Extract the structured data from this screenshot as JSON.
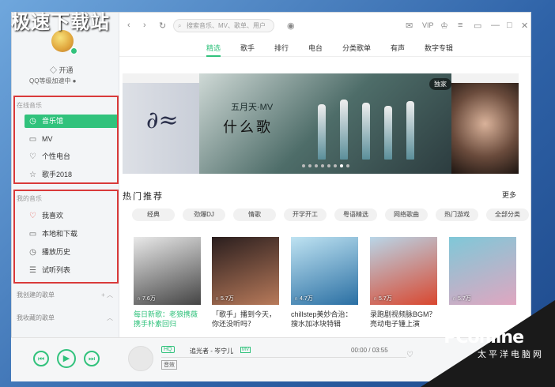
{
  "watermark_top": "极速下载站",
  "sidebar": {
    "vip_label": "开通",
    "qq_accel": "QQ等级加速中",
    "online_section": "在线音乐",
    "online_items": [
      {
        "label": "音乐馆",
        "icon": "music-hall-icon",
        "active": true
      },
      {
        "label": "MV",
        "icon": "mv-icon",
        "active": false
      },
      {
        "label": "个性电台",
        "icon": "radio-icon",
        "active": false
      },
      {
        "label": "歌手2018",
        "icon": "star-icon",
        "active": false
      }
    ],
    "my_section": "我的音乐",
    "my_items": [
      {
        "label": "我喜欢",
        "icon": "heart-icon"
      },
      {
        "label": "本地和下载",
        "icon": "monitor-icon"
      },
      {
        "label": "播放历史",
        "icon": "clock-icon"
      },
      {
        "label": "试听列表",
        "icon": "list-icon"
      }
    ],
    "created_lists": "我创建的歌单",
    "collected_lists": "我收藏的歌单"
  },
  "topbar": {
    "search_placeholder": "搜索音乐、MV、歌单、用户",
    "vip": "VIP"
  },
  "tabs": [
    "精选",
    "歌手",
    "排行",
    "电台",
    "分类歌单",
    "有声",
    "数字专辑"
  ],
  "banner": {
    "line1": "五月天·MV",
    "line2": "什么歌",
    "badge": "独家",
    "dot_count": 8,
    "active_dot": 6
  },
  "hot": {
    "title": "热门推荐",
    "more": "更多",
    "chips": [
      "经典",
      "劲爆DJ",
      "情歌",
      "开学开工",
      "粤语精选",
      "网络歌曲",
      "热门游戏",
      "全部分类"
    ],
    "cards": [
      {
        "plays": "7.6万",
        "caption": "每日新歌：老狼携薇携手朴素回归",
        "green": true,
        "color1": "#e9e9e9",
        "color2": "#444"
      },
      {
        "plays": "5.7万",
        "caption": "「歌手」播到今天，你还没听吗？",
        "green": false,
        "color1": "#2a1e1e",
        "color2": "#b87a5a"
      },
      {
        "plays": "4.7万",
        "caption": "chillstep美妙合治：搜水加冰块特辑",
        "green": false,
        "color1": "#bfe3f2",
        "color2": "#2a6fa3"
      },
      {
        "plays": "5.7万",
        "caption": "录跑剧视频脉BGM？亮动电子锺上演",
        "green": false,
        "color1": "#b9d6e8",
        "color2": "#d9472f"
      },
      {
        "plays": "5.7万",
        "caption": "",
        "green": false,
        "color1": "#7fc8d8",
        "color2": "#e0a6c0"
      }
    ]
  },
  "player": {
    "quality": "HQ",
    "song": "追光者 - 岑宁儿",
    "mv": "MV",
    "time": "00:00 / 03:55",
    "effect": "音效"
  },
  "watermark_brand": "PConline",
  "watermark_cn": "太平洋电脑网"
}
